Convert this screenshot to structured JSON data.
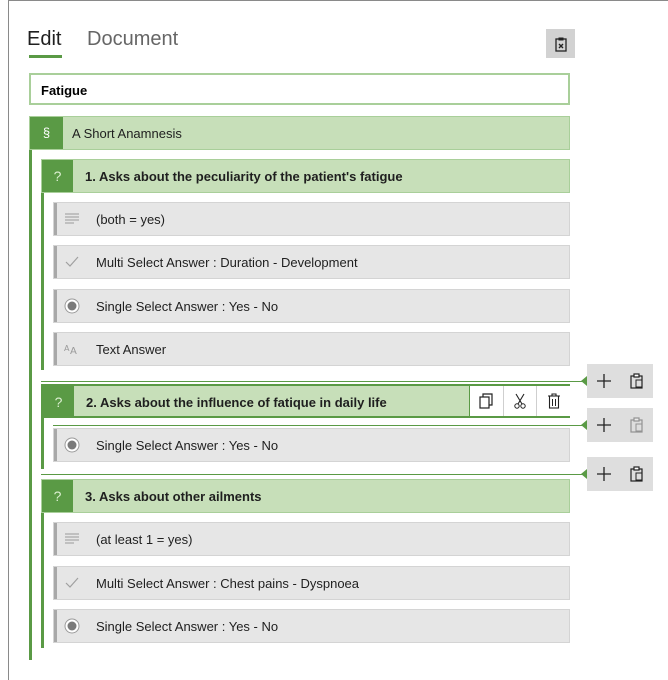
{
  "tabs": {
    "edit": "Edit",
    "document": "Document"
  },
  "document_title": "Fatigue",
  "section": {
    "badge": "§",
    "label": "A  Short Anamnesis"
  },
  "questions": [
    {
      "badge": "?",
      "label": "1.  Asks about the peculiarity of the patient's fatigue",
      "answers": [
        {
          "icon": "lines-icon",
          "label": "(both = yes)"
        },
        {
          "icon": "checkmark-icon",
          "label": "Multi Select Answer : Duration - Development"
        },
        {
          "icon": "radio-icon",
          "label": "Single Select Answer : Yes - No"
        },
        {
          "icon": "text-size-icon",
          "label": "Text Answer"
        }
      ]
    },
    {
      "badge": "?",
      "label": "2.  Asks about the influence of fatique in daily life",
      "answers": [
        {
          "icon": "radio-icon",
          "label": "Single Select Answer : Yes - No"
        }
      ]
    },
    {
      "badge": "?",
      "label": "3.  Asks about other ailments",
      "answers": [
        {
          "icon": "lines-icon",
          "label": "(at least 1 = yes)"
        },
        {
          "icon": "checkmark-icon",
          "label": "Multi Select Answer : Chest pains - Dyspnoea"
        },
        {
          "icon": "radio-icon",
          "label": "Single Select Answer : Yes - No"
        }
      ]
    }
  ],
  "colors": {
    "accent": "#5a9a45",
    "item_bg": "#c7dfb9",
    "answer_bg": "#e6e6e6"
  }
}
